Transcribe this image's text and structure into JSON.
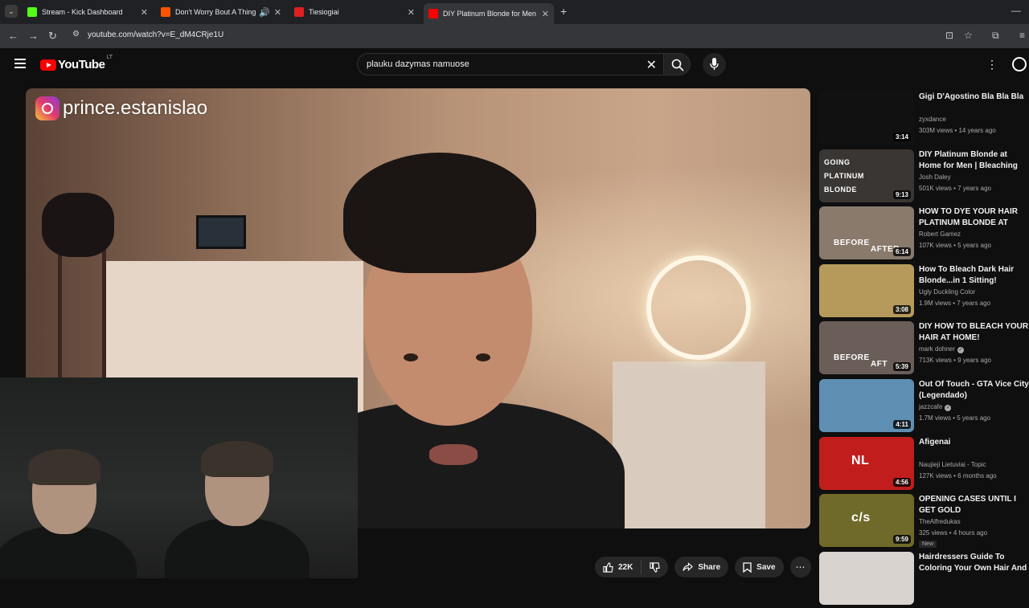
{
  "browser": {
    "tabs": [
      {
        "title": "Stream - Kick Dashboard",
        "favicon_color": "#53fc18"
      },
      {
        "title": "Don't Worry Bout A Thing",
        "favicon_color": "#ff5500"
      },
      {
        "title": "Tiesiogiai",
        "favicon_color": "#e02020"
      },
      {
        "title": "DIY Platinum Blonde for Men |",
        "favicon_color": "#ff0000"
      }
    ],
    "url": "youtube.com/watch?v=E_dM4CRje1U"
  },
  "header": {
    "logo_text": "YouTube",
    "country_code": "LT",
    "search_query": "plauku dazymas namuose"
  },
  "video": {
    "overlay_handle": "prince.estanislao"
  },
  "actions": {
    "likes": "22K",
    "share": "Share",
    "save": "Save"
  },
  "recommendations": [
    {
      "title": "Gigi D'Agostino Bla Bla Bla",
      "channel": "zyxdance",
      "verified": false,
      "meta": "303M views • 14 years ago",
      "duration": "3:14",
      "thumb_color": "#111111",
      "badge": ""
    },
    {
      "title": "DIY Platinum Blonde at Home for Men | Bleaching My Hair fo...",
      "channel": "Josh Daley",
      "verified": false,
      "meta": "501K views • 7 years ago",
      "duration": "9:13",
      "thumb_color": "#3a3633",
      "badge": "",
      "thumb_text": [
        "GOING",
        "PLATINUM",
        "BLONDE"
      ]
    },
    {
      "title": "HOW TO DYE YOUR HAIR PLATINUM BLONDE AT HOME ...",
      "channel": "Robert Gamez",
      "verified": false,
      "meta": "107K views • 5 years ago",
      "duration": "6:14",
      "thumb_color": "#8a7a6c",
      "badge": "",
      "thumb_text": [
        "BEFORE",
        "AFTER"
      ]
    },
    {
      "title": "How To Bleach Dark Hair Blonde...in 1 Sitting!",
      "channel": "Ugly Duckling Color",
      "verified": false,
      "meta": "1.9M views • 7 years ago",
      "duration": "3:08",
      "thumb_color": "#b59a5c",
      "badge": ""
    },
    {
      "title": "DIY HOW TO BLEACH YOUR HAIR AT HOME!",
      "channel": "mark dohner",
      "verified": true,
      "meta": "713K views • 9 years ago",
      "duration": "5:39",
      "thumb_color": "#6b5e58",
      "badge": "",
      "thumb_text": [
        "BEFORE",
        "AFT"
      ]
    },
    {
      "title": "Out Of Touch - GTA Vice City (Legendado)",
      "channel": "jazzcafe",
      "verified": true,
      "meta": "1.7M views • 5 years ago",
      "duration": "4:11",
      "thumb_color": "#5e8fb3",
      "badge": ""
    },
    {
      "title": "Afigenai",
      "channel": "Naujieji Lietuviai - Topic",
      "verified": false,
      "meta": "127K views • 6 months ago",
      "duration": "4:56",
      "thumb_color": "#c21d1d",
      "badge": "",
      "thumb_text": [
        "NL"
      ]
    },
    {
      "title": "OPENING CASES UNTIL I GET GOLD",
      "channel": "TheAlfredukas",
      "verified": false,
      "meta": "325 views • 4 hours ago",
      "duration": "9:59",
      "thumb_color": "#6f6a2a",
      "badge": "New",
      "thumb_text": [
        "c/s"
      ]
    },
    {
      "title": "Hairdressers Guide To Coloring Your Own Hair And Not Ruinin...",
      "channel": "",
      "verified": false,
      "meta": "",
      "duration": "",
      "thumb_color": "#d9d3cf",
      "badge": ""
    }
  ]
}
